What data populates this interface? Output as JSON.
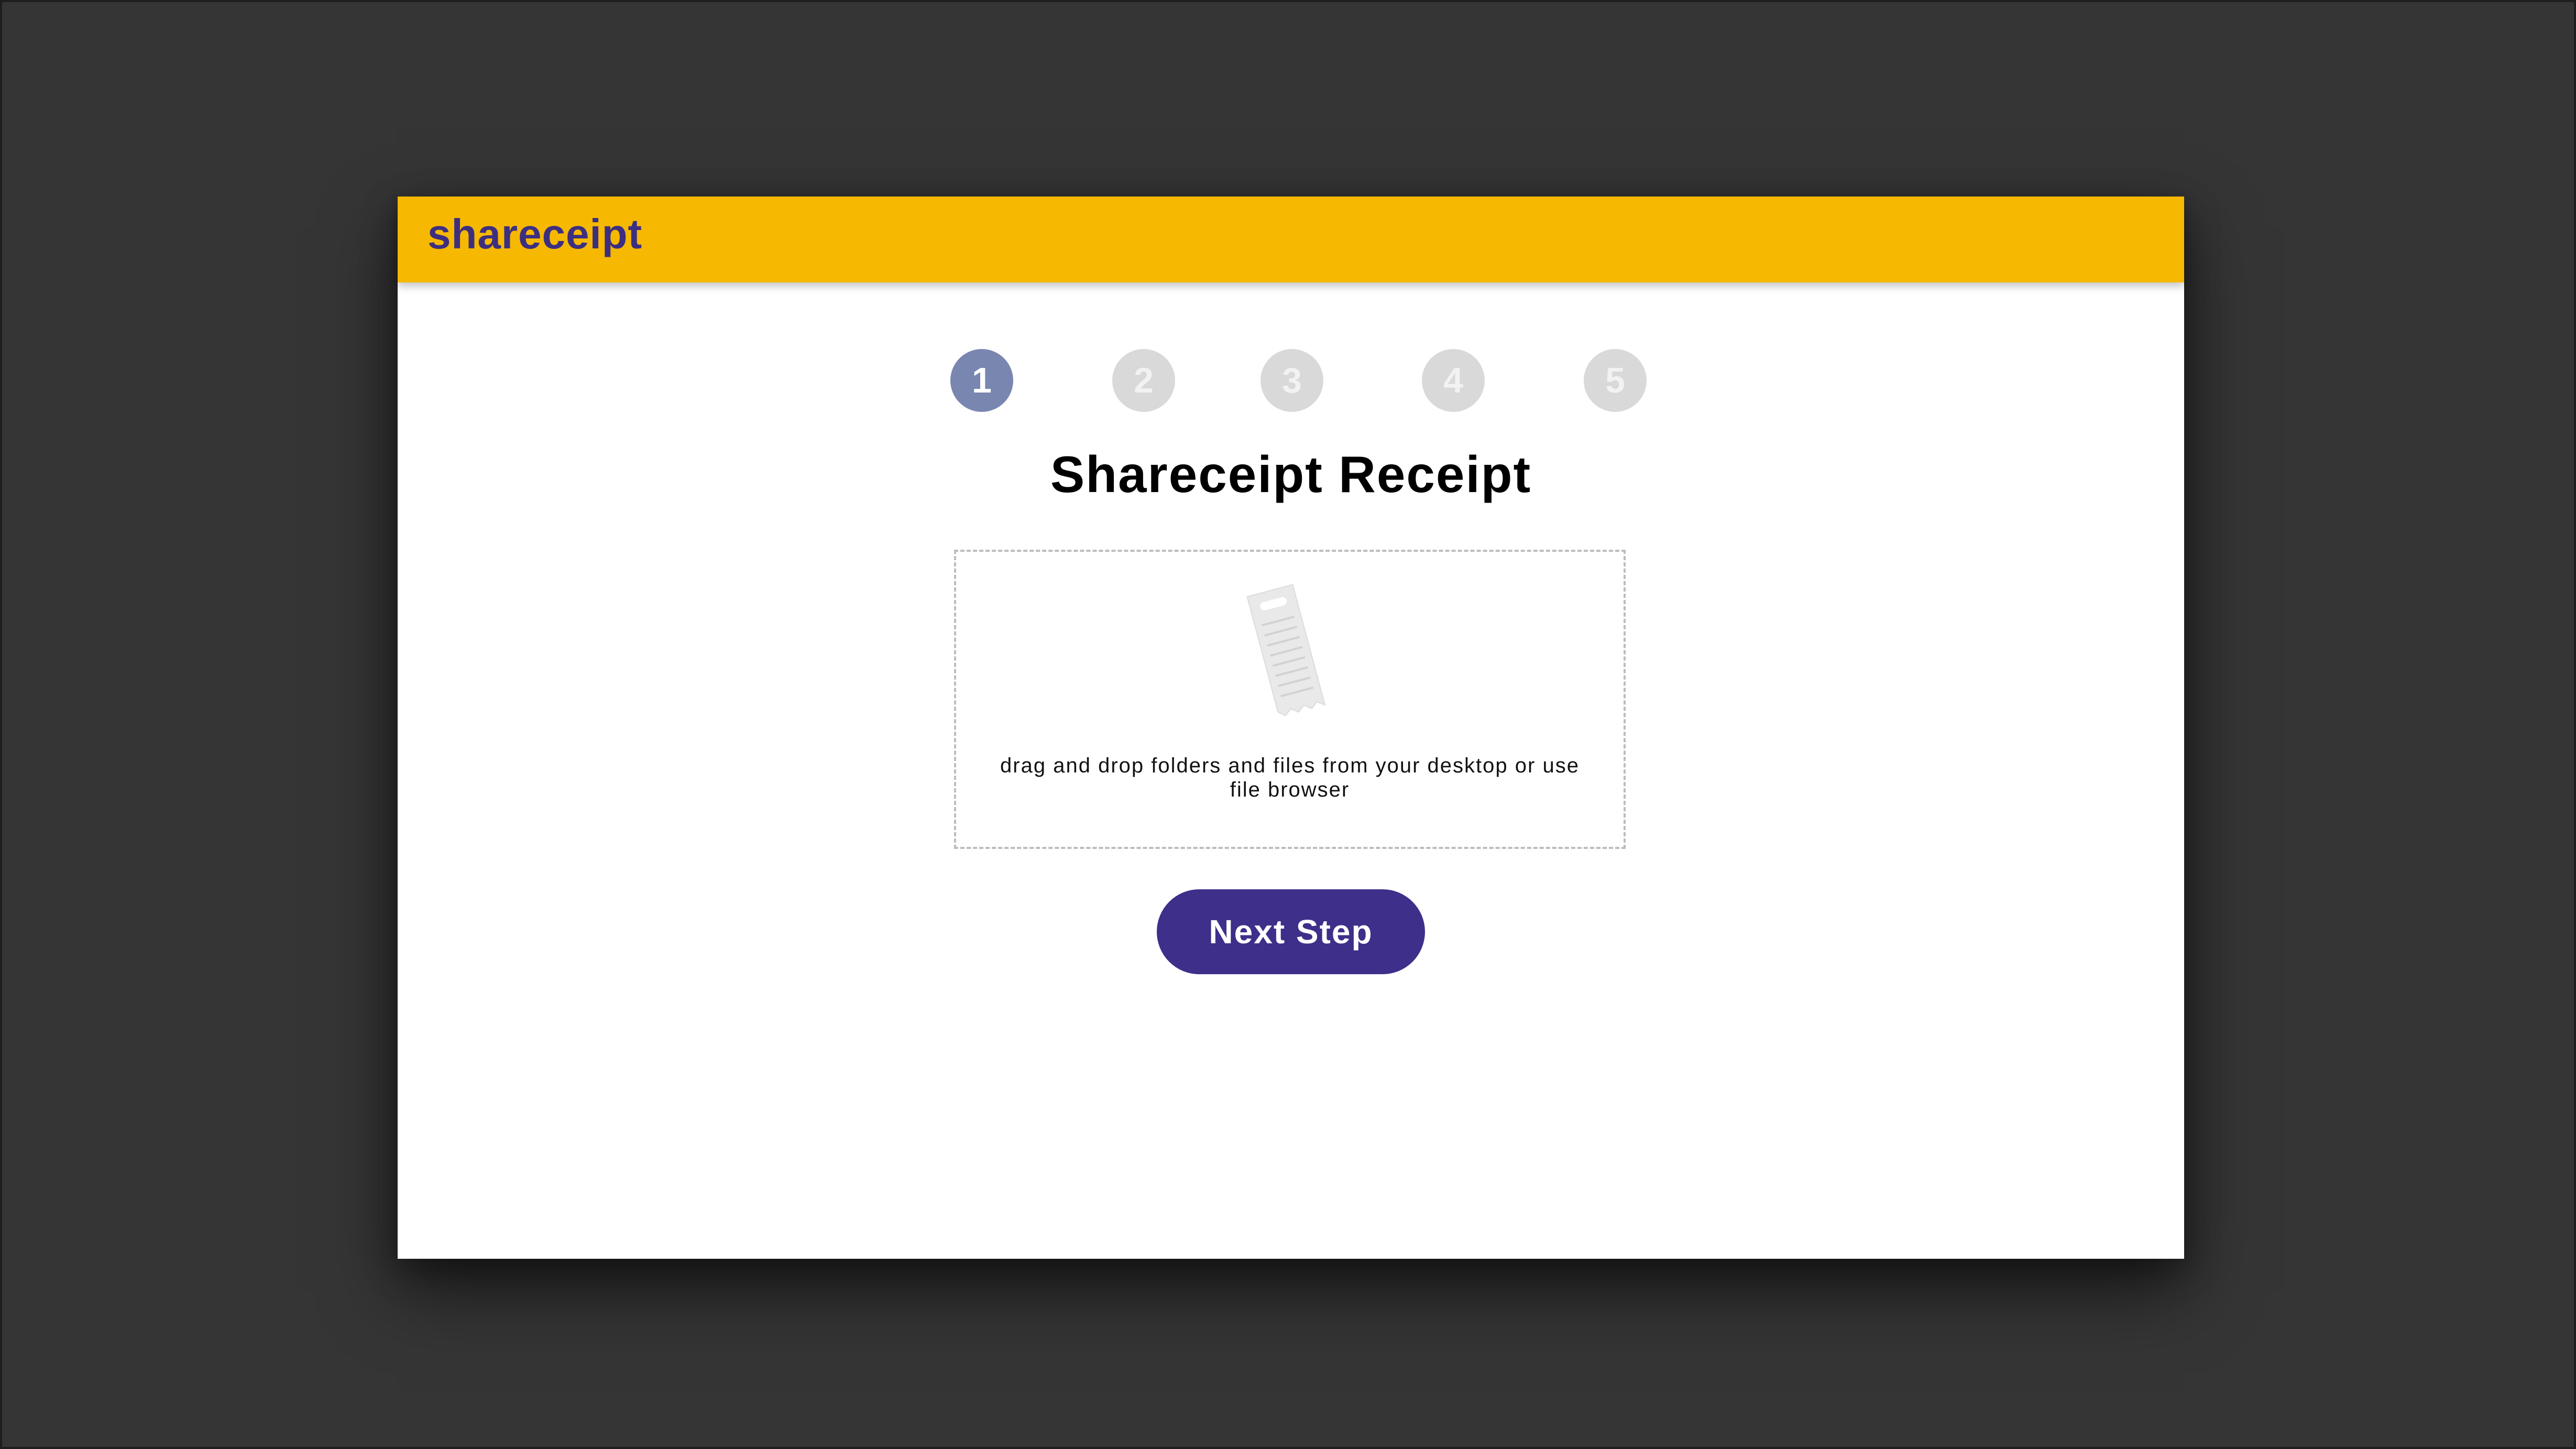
{
  "app": {
    "brand": "shareceipt",
    "brand_color": "#3d2f80",
    "header_color": "#f6b800"
  },
  "stepper": {
    "active_step": 1,
    "steps": [
      {
        "label": "1",
        "state": "active"
      },
      {
        "label": "2",
        "state": "inactive"
      },
      {
        "label": "3",
        "state": "inactive"
      },
      {
        "label": "4",
        "state": "inactive"
      },
      {
        "label": "5",
        "state": "inactive"
      }
    ],
    "active_color": "#7986b0",
    "inactive_color": "#d9d9d9"
  },
  "main": {
    "title": "Shareceipt Receipt",
    "dropzone": {
      "icon": "receipt-icon",
      "instruction": "drag and drop folders and files from your desktop or use file browser"
    },
    "next_button_label": "Next Step",
    "next_button_color": "#3d2f8a"
  }
}
